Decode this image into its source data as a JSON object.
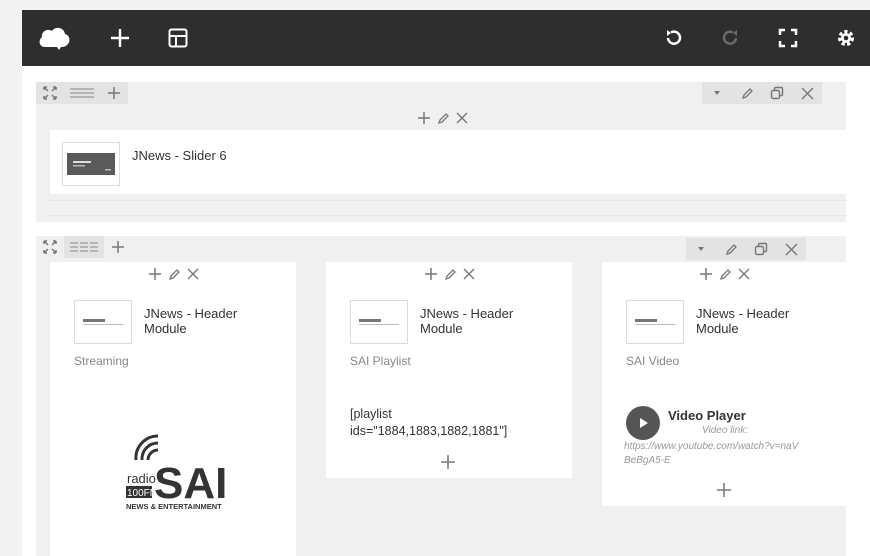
{
  "toolbar": {
    "icons": [
      "cloud-icon",
      "plus-icon",
      "layout-icon",
      "undo-icon",
      "redo-icon",
      "fullscreen-icon",
      "gear-icon"
    ]
  },
  "row1": {
    "controls": {
      "symbol": "+ ✎ ✕"
    },
    "element": {
      "name": "JNews - Slider 6"
    }
  },
  "row2": {
    "columns": [
      {
        "controls": "+ ✎ ✕",
        "element_name": "JNews - Header Module",
        "subtitle": "Streaming",
        "logo": {
          "radio": "radio",
          "freq": "100FM",
          "brand": "SAI",
          "tagline": "NEWS & ENTERTAINMENT"
        }
      },
      {
        "controls": "+ ✎ ✕",
        "element_name": "JNews - Header Module",
        "subtitle": "SAI Playlist",
        "shortcode": "[playlist ids=\"1884,1883,1882,1881\"]"
      },
      {
        "controls": "+ ✎ ✕",
        "element_name": "JNews - Header Module",
        "subtitle": "SAI Video",
        "video": {
          "title": "Video Player",
          "link_label": "Video link:",
          "url": "https://www.youtube.com/watch?v=naVBeBgA5-E"
        }
      }
    ]
  },
  "colors": {
    "toolbar": "#2e2e2e",
    "control_bg": "#e3e3e3",
    "row_bg": "#f0f0f0"
  }
}
